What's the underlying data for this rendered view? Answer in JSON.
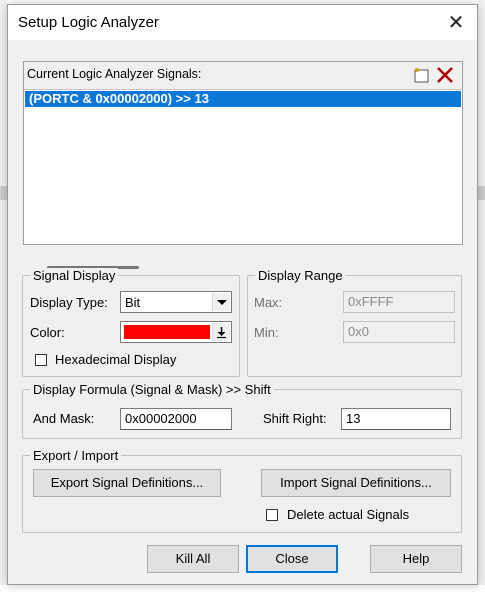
{
  "dialog": {
    "title": "Setup Logic Analyzer",
    "close_glyph": "✕"
  },
  "signals": {
    "header_label": "Current Logic Analyzer Signals:",
    "new_icon": "new-signal-icon",
    "delete_icon": "delete-signal-icon",
    "items": [
      {
        "label": "(PORTC & 0x00002000) >> 13",
        "selected": true
      }
    ]
  },
  "signal_display": {
    "group_title": "Signal Display",
    "display_type_label": "Display Type:",
    "display_type_value": "Bit",
    "color_label": "Color:",
    "color_value": "#ff0000",
    "hex_display_label": "Hexadecimal Display",
    "hex_display_checked": false
  },
  "display_range": {
    "group_title": "Display Range",
    "max_label": "Max:",
    "max_value": "0xFFFF",
    "min_label": "Min:",
    "min_value": "0x0"
  },
  "formula": {
    "group_title": "Display Formula (Signal & Mask) >> Shift",
    "and_mask_label": "And Mask:",
    "and_mask_value": "0x00002000",
    "shift_right_label": "Shift Right:",
    "shift_right_value": "13"
  },
  "export_import": {
    "group_title": "Export / Import",
    "export_button": "Export Signal Definitions...",
    "import_button": "Import Signal Definitions...",
    "delete_signals_label": "Delete actual Signals",
    "delete_signals_checked": false
  },
  "buttons": {
    "kill_all": "Kill All",
    "close": "Close",
    "help": "Help"
  }
}
